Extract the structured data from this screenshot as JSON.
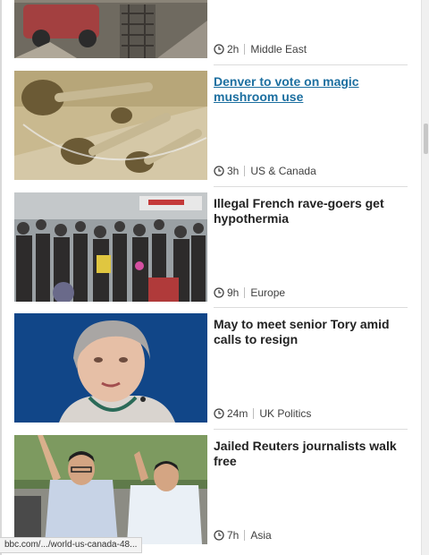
{
  "stories": [
    {
      "headline": "",
      "time": "2h",
      "section": "Middle East"
    },
    {
      "headline": "Denver to vote on magic mushroom use",
      "time": "3h",
      "section": "US & Canada"
    },
    {
      "headline": "Illegal French rave-goers get hypothermia",
      "time": "9h",
      "section": "Europe"
    },
    {
      "headline": "May to meet senior Tory amid calls to resign",
      "time": "24m",
      "section": "UK Politics"
    },
    {
      "headline": "Jailed Reuters journalists walk free",
      "time": "7h",
      "section": "Asia"
    }
  ],
  "status_bar": {
    "url": "bbc.com/.../world-us-canada-48..."
  },
  "colors": {
    "link_active": "#1c6fa0",
    "headline": "#222222",
    "meta": "#404040"
  },
  "icons": {
    "timestamp": "clock-icon"
  }
}
